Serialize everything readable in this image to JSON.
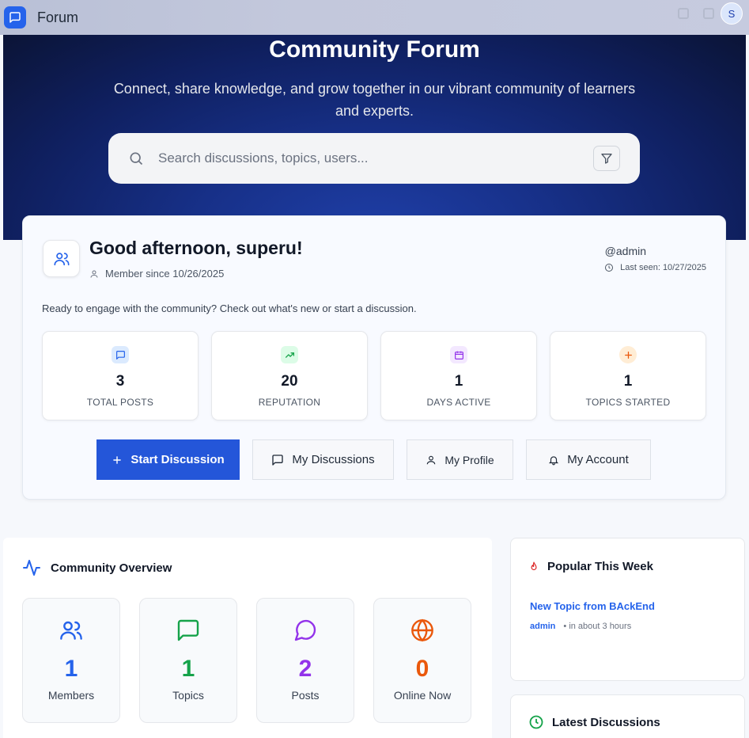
{
  "topbar": {
    "app_name": "Forum",
    "avatar_initial": "S"
  },
  "hero": {
    "title": "Community Forum",
    "subtitle": "Connect, share knowledge, and grow together in our vibrant community of learners and experts.",
    "search_placeholder": "Search discussions, topics, users..."
  },
  "welcome": {
    "greeting": "Good afternoon, superu!",
    "member_since": "Member since 10/26/2025",
    "handle": "@admin",
    "last_seen": "Last seen: 10/27/2025",
    "prompt": "Ready to engage with the community? Check out what's new or start a discussion.",
    "stats": [
      {
        "value": "3",
        "label": "TOTAL POSTS",
        "icon": "message-square-icon",
        "color": "#2563eb"
      },
      {
        "value": "20",
        "label": "REPUTATION",
        "icon": "trending-up-icon",
        "color": "#16a34a"
      },
      {
        "value": "1",
        "label": "DAYS ACTIVE",
        "icon": "calendar-icon",
        "color": "#9333ea"
      },
      {
        "value": "1",
        "label": "TOPICS STARTED",
        "icon": "plus-icon",
        "color": "#ea580c"
      }
    ],
    "actions": {
      "start": "Start Discussion",
      "my_discussions": "My Discussions",
      "my_profile": "My Profile",
      "my_account": "My Account"
    }
  },
  "overview": {
    "title": "Community Overview",
    "cards": [
      {
        "value": "1",
        "label": "Members",
        "color": "#2563eb",
        "icon": "users-icon"
      },
      {
        "value": "1",
        "label": "Topics",
        "color": "#16a34a",
        "icon": "message-square-icon"
      },
      {
        "value": "2",
        "label": "Posts",
        "color": "#9333ea",
        "icon": "message-circle-icon"
      },
      {
        "value": "0",
        "label": "Online Now",
        "color": "#ea580c",
        "icon": "globe-icon"
      }
    ]
  },
  "popular": {
    "title": "Popular This Week",
    "topic_title": "New Topic from BAckEnd",
    "author": "admin",
    "time": "• in about 3 hours"
  },
  "latest": {
    "title": "Latest Discussions"
  }
}
